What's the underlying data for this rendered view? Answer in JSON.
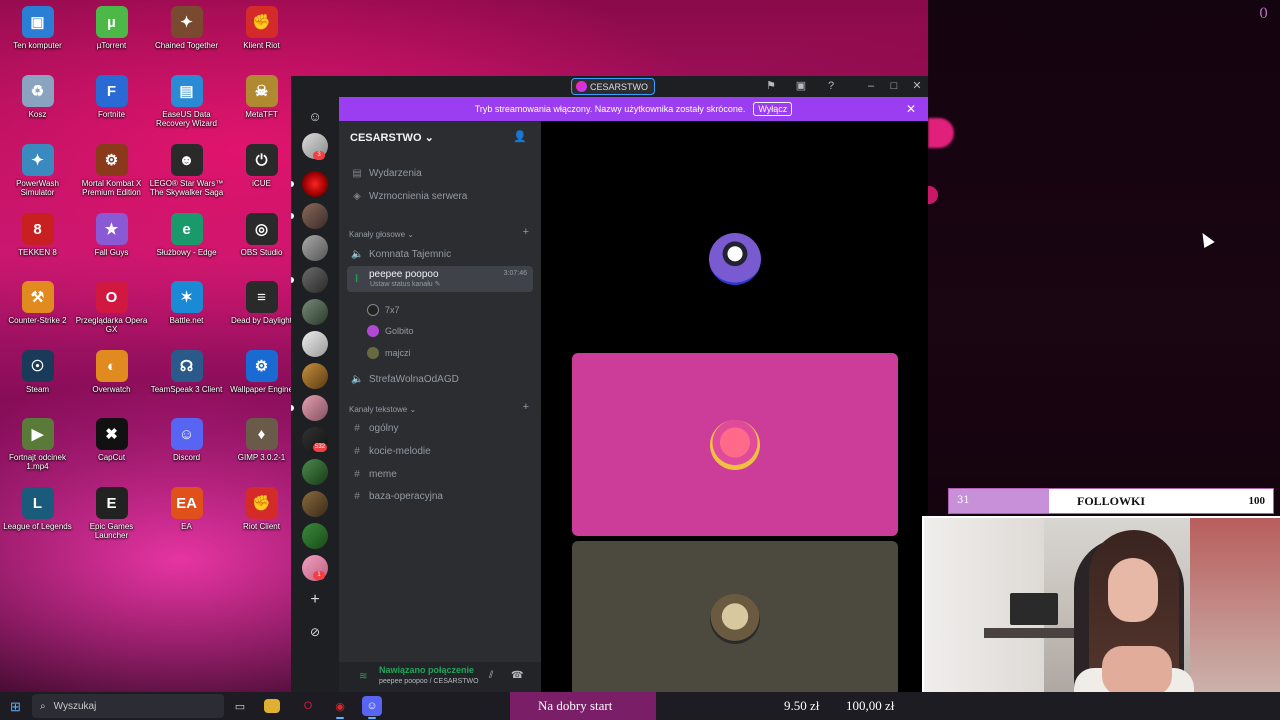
{
  "desktop": {
    "icons": [
      {
        "label": "Ten komputer",
        "icon": "monitor-icon",
        "color": "#2a7fd4",
        "glyph": "▣"
      },
      {
        "label": "µTorrent",
        "icon": "utorrent-icon",
        "color": "#4cb848",
        "glyph": "µ"
      },
      {
        "label": "Chained Together",
        "icon": "chained-together-icon",
        "color": "#7a4a30",
        "glyph": "✦"
      },
      {
        "label": "Klient Riot",
        "icon": "riot-icon",
        "color": "#d42a2a",
        "glyph": "✊"
      },
      {
        "label": "Kosz",
        "icon": "recycle-bin-icon",
        "color": "#8aa4c0",
        "glyph": "♻"
      },
      {
        "label": "Fortnite",
        "icon": "fortnite-icon",
        "color": "#2a6ad4",
        "glyph": "F"
      },
      {
        "label": "EaseUS Data Recovery Wizard",
        "icon": "easeus-icon",
        "color": "#2a8ad4",
        "glyph": "▤"
      },
      {
        "label": "MetaTFT",
        "icon": "metatft-icon",
        "color": "#b08a30",
        "glyph": "☠"
      },
      {
        "label": "PowerWash Simulator",
        "icon": "powerwash-icon",
        "color": "#3a8ac0",
        "glyph": "✦"
      },
      {
        "label": "Mortal Kombat X Premium Edition",
        "icon": "mortal-kombat-icon",
        "color": "#8a3a1a",
        "glyph": "⚙"
      },
      {
        "label": "LEGO® Star Wars™ The Skywalker Saga",
        "icon": "lego-starwars-icon",
        "color": "#2a2a2a",
        "glyph": "☻"
      },
      {
        "label": "iCUE",
        "icon": "icue-icon",
        "color": "#2a2a2a",
        "glyph": "⏻"
      },
      {
        "label": "TEKKEN 8",
        "icon": "tekken-icon",
        "color": "#c82020",
        "glyph": "8"
      },
      {
        "label": "Fall Guys",
        "icon": "fall-guys-icon",
        "color": "#8a5ad4",
        "glyph": "★"
      },
      {
        "label": "Służbowy - Edge",
        "icon": "edge-icon",
        "color": "#1a9a6a",
        "glyph": "e"
      },
      {
        "label": "OBS Studio",
        "icon": "obs-icon",
        "color": "#2a2a2a",
        "glyph": "◎"
      },
      {
        "label": "Counter-Strike 2",
        "icon": "cs2-icon",
        "color": "#e08a20",
        "glyph": "⚒"
      },
      {
        "label": "Przeglądarka Opera GX",
        "icon": "opera-gx-icon",
        "color": "#d01840",
        "glyph": "O"
      },
      {
        "label": "Battle.net",
        "icon": "battlenet-icon",
        "color": "#1a8ad4",
        "glyph": "✶"
      },
      {
        "label": "Dead by Daylight",
        "icon": "dbd-icon",
        "color": "#2a2a2a",
        "glyph": "≡"
      },
      {
        "label": "Steam",
        "icon": "steam-icon",
        "color": "#1a3a5a",
        "glyph": "☉"
      },
      {
        "label": "Overwatch",
        "icon": "overwatch-icon",
        "color": "#e08a20",
        "glyph": "◐"
      },
      {
        "label": "TeamSpeak 3 Client",
        "icon": "teamspeak-icon",
        "color": "#2a5a8a",
        "glyph": "☊"
      },
      {
        "label": "Wallpaper Engine",
        "icon": "wallpaper-engine-icon",
        "color": "#1a6ad4",
        "glyph": "⚙"
      },
      {
        "label": "Fortnajt odcinek 1.mp4",
        "icon": "video-file-icon",
        "color": "#5a7a3a",
        "glyph": "▶"
      },
      {
        "label": "CapCut",
        "icon": "capcut-icon",
        "color": "#111111",
        "glyph": "✖"
      },
      {
        "label": "Discord",
        "icon": "discord-icon",
        "color": "#5865f2",
        "glyph": "☺"
      },
      {
        "label": "GIMP 3.0.2-1",
        "icon": "gimp-icon",
        "color": "#6a5a4a",
        "glyph": "♦"
      },
      {
        "label": "League of Legends",
        "icon": "lol-icon",
        "color": "#1a5a7a",
        "glyph": "L"
      },
      {
        "label": "Epic Games Launcher",
        "icon": "epic-games-icon",
        "color": "#222222",
        "glyph": "E"
      },
      {
        "label": "EA",
        "icon": "ea-icon",
        "color": "#e0501a",
        "glyph": "EA"
      },
      {
        "label": "Riot Client",
        "icon": "riot-client-icon",
        "color": "#d42a2a",
        "glyph": "✊"
      }
    ]
  },
  "overlay_top_right": "0",
  "discord": {
    "titlebar": {
      "server_name": "CESARSTWO"
    },
    "banner": {
      "text": "Tryb streamowania włączony. Nazwy użytkownika zostały skrócone.",
      "button": "Wyłącz"
    },
    "server": {
      "name": "CESARSTWO"
    },
    "nav": [
      {
        "label": "Wydarzenia",
        "icon": "calendar-icon"
      },
      {
        "label": "Wzmocnienia serwera",
        "icon": "boost-icon"
      }
    ],
    "voice_category": "Kanały głosowe",
    "voice_channels": [
      {
        "label": "Komnata Tajemnic"
      },
      {
        "label": "peepee poopoo",
        "timer": "3:07:46",
        "status": "Ustaw status kanału"
      },
      {
        "label": "StrefaWolnaOdAGD"
      }
    ],
    "voice_users": [
      {
        "name": "7x7",
        "color": "#222222"
      },
      {
        "name": "Golbito",
        "color": "#b04ad0"
      },
      {
        "name": "majczi",
        "color": "#6a6a40"
      }
    ],
    "text_category": "Kanały tekstowe",
    "text_channels": [
      {
        "label": "ogólny"
      },
      {
        "label": "kocie-melodie"
      },
      {
        "label": "meme"
      },
      {
        "label": "baza-operacyjna"
      }
    ],
    "rail_badges": {
      "first": "3",
      "second": "532",
      "third": "1"
    },
    "connection": {
      "status": "Nawiązano połączenie",
      "channel": "peepee poopoo / CESARSTWO"
    },
    "stage_tiles_colors": {
      "top": "#000000",
      "middle": "#cc3d9a",
      "bottom": "#4c4a3e"
    }
  },
  "follows": {
    "current": "31",
    "label": "FOLLOWKI",
    "goal": "100",
    "progress": 0.31
  },
  "taskbar": {
    "search_placeholder": "Wyszukaj"
  },
  "donation_goal": {
    "title": "Na dobry start",
    "current": "9.50 zł",
    "target": "100,00 zł"
  }
}
